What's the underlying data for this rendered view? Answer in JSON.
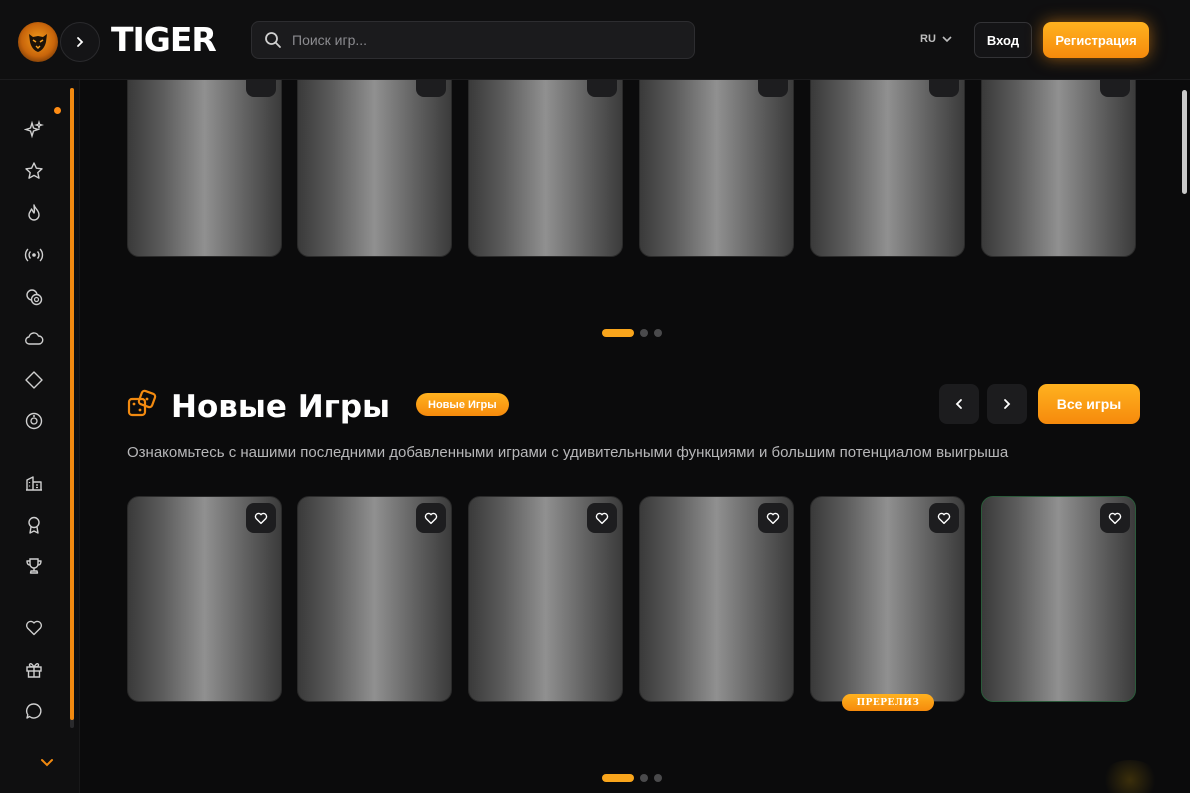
{
  "header": {
    "brand": "TIGER",
    "search_placeholder": "Поиск игр...",
    "language": "RU",
    "login_label": "Вход",
    "register_label": "Регистрация"
  },
  "sidebar": {
    "items": [
      {
        "icon": "sparkles-icon"
      },
      {
        "icon": "star-icon"
      },
      {
        "icon": "flame-icon"
      },
      {
        "icon": "live-signal-icon"
      },
      {
        "icon": "chips-icon"
      },
      {
        "icon": "cloud-icon"
      },
      {
        "icon": "diamond-icon"
      },
      {
        "icon": "roulette-icon"
      },
      {
        "icon": "provider-building-icon"
      },
      {
        "icon": "award-ribbon-icon"
      },
      {
        "icon": "trophy-icon"
      },
      {
        "icon": "heart-icon"
      },
      {
        "icon": "gift-icon"
      },
      {
        "icon": "chat-icon"
      }
    ]
  },
  "top_carousel": {
    "cards": 6,
    "active_page": 1,
    "pages": 3
  },
  "new_games": {
    "title": "Новые Игры",
    "badge": "Новые Игры",
    "description": "Ознакомьтесь с нашими последними добавленными играми с удивительными функциями и большим потенциалом выигрыша",
    "all_games_label": "Все игры",
    "prerelease_label": "ПРЕРЕЛИЗ",
    "cards": 6,
    "active_page": 1,
    "pages": 3
  },
  "colors": {
    "accent": "#f9a51c",
    "accent_dark": "#f68a0c",
    "background": "#0b0b0c",
    "panel": "#0f0f10"
  }
}
